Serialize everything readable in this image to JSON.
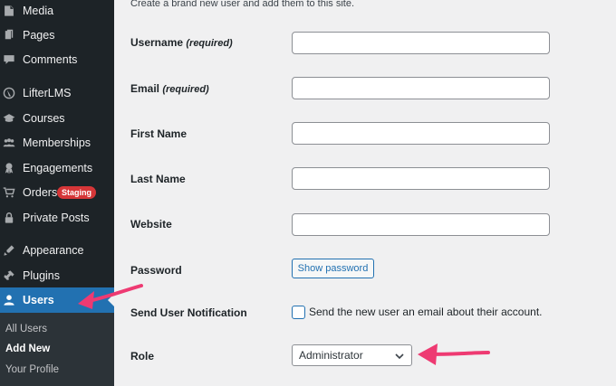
{
  "sidebar": {
    "items": [
      {
        "label": "Media",
        "icon": "media-icon"
      },
      {
        "label": "Pages",
        "icon": "pages-icon"
      },
      {
        "label": "Comments",
        "icon": "comments-icon"
      },
      {
        "label": "LifterLMS",
        "icon": "lifterlms-icon"
      },
      {
        "label": "Courses",
        "icon": "courses-icon"
      },
      {
        "label": "Memberships",
        "icon": "memberships-icon"
      },
      {
        "label": "Engagements",
        "icon": "engagements-icon"
      },
      {
        "label": "Orders",
        "icon": "orders-icon",
        "badge": "Staging"
      },
      {
        "label": "Private Posts",
        "icon": "lock-icon"
      },
      {
        "label": "Appearance",
        "icon": "appearance-icon"
      },
      {
        "label": "Plugins",
        "icon": "plugins-icon"
      },
      {
        "label": "Users",
        "icon": "users-icon",
        "active": true
      }
    ],
    "submenu": [
      {
        "label": "All Users"
      },
      {
        "label": "Add New",
        "current": true
      },
      {
        "label": "Your Profile"
      }
    ]
  },
  "form": {
    "intro": "Create a brand new user and add them to this site.",
    "username": {
      "label": "Username",
      "req": "(required)",
      "value": ""
    },
    "email": {
      "label": "Email",
      "req": "(required)",
      "value": ""
    },
    "first_name": {
      "label": "First Name",
      "value": ""
    },
    "last_name": {
      "label": "Last Name",
      "value": ""
    },
    "website": {
      "label": "Website",
      "value": ""
    },
    "password": {
      "label": "Password",
      "button": "Show password"
    },
    "notification": {
      "label": "Send User Notification",
      "checkbox_label": "Send the new user an email about their account.",
      "checked": false
    },
    "role": {
      "label": "Role",
      "selected": "Administrator"
    }
  },
  "colors": {
    "sidebar_bg": "#1d2327",
    "active_bg": "#2271b1",
    "badge": "#d63638",
    "annotation_arrow": "#ee3a72"
  }
}
